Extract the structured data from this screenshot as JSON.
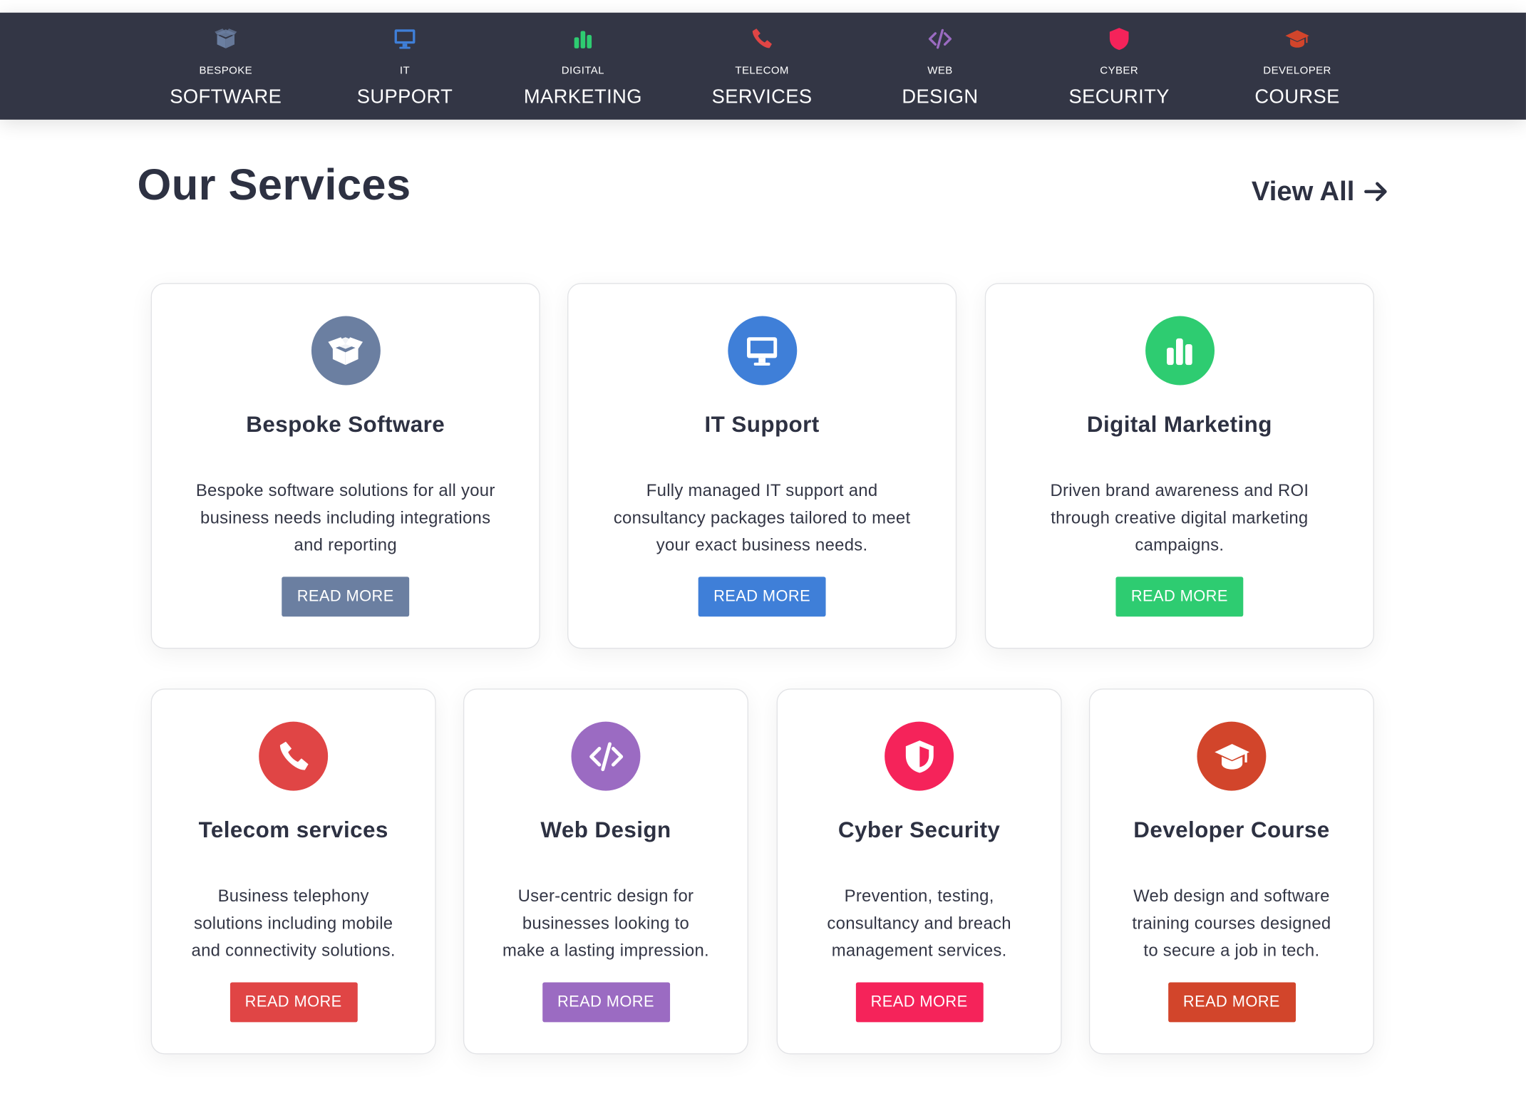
{
  "nav": {
    "items": [
      {
        "small": "BESPOKE",
        "big": "SOFTWARE",
        "icon": "box-open-icon",
        "color": "#6b7fa1"
      },
      {
        "small": "IT",
        "big": "SUPPORT",
        "icon": "desktop-icon",
        "color": "#3f7fd8"
      },
      {
        "small": "DIGITAL",
        "big": "MARKETING",
        "icon": "bar-chart-icon",
        "color": "#2ecc71"
      },
      {
        "small": "TELECOM",
        "big": "SERVICES",
        "icon": "phone-icon",
        "color": "#e04545"
      },
      {
        "small": "WEB",
        "big": "DESIGN",
        "icon": "code-icon",
        "color": "#9b6bc2"
      },
      {
        "small": "CYBER",
        "big": "SECURITY",
        "icon": "shield-icon",
        "color": "#f5235a"
      },
      {
        "small": "DEVELOPER",
        "big": "COURSE",
        "icon": "graduation-cap-icon",
        "color": "#d2452b"
      }
    ]
  },
  "main": {
    "title": "Our Services",
    "view_all": "View All"
  },
  "services": [
    {
      "title": "Bespoke Software",
      "lines": [
        "Bespoke software solutions for all your",
        "business needs including integrations",
        "and reporting"
      ],
      "button": "READ MORE",
      "icon": "box-open-icon",
      "color": "#6b7fa1"
    },
    {
      "title": "IT Support",
      "lines": [
        "Fully managed IT support and",
        "consultancy packages tailored to meet",
        "your exact business needs."
      ],
      "button": "READ MORE",
      "icon": "desktop-icon",
      "color": "#3f7fd8"
    },
    {
      "title": "Digital Marketing",
      "lines": [
        "Driven brand awareness and ROI",
        "through creative digital marketing",
        "campaigns."
      ],
      "button": "READ MORE",
      "icon": "bar-chart-icon",
      "color": "#2ecc71"
    },
    {
      "title": "Telecom services",
      "lines": [
        "Business telephony",
        "solutions including mobile",
        "and connectivity solutions."
      ],
      "button": "READ MORE",
      "icon": "phone-icon",
      "color": "#e04545"
    },
    {
      "title": "Web Design",
      "lines": [
        "User-centric design for",
        "businesses looking to",
        "make a lasting impression."
      ],
      "button": "READ MORE",
      "icon": "code-icon",
      "color": "#9b6bc2"
    },
    {
      "title": "Cyber Security",
      "lines": [
        "Prevention, testing,",
        "consultancy and breach",
        "management services."
      ],
      "button": "READ MORE",
      "icon": "shield-icon",
      "color": "#f5235a"
    },
    {
      "title": "Developer Course",
      "lines": [
        "Web design and software",
        "training courses designed",
        "to secure a job in tech."
      ],
      "button": "READ MORE",
      "icon": "graduation-cap-icon",
      "color": "#d2452b"
    }
  ]
}
